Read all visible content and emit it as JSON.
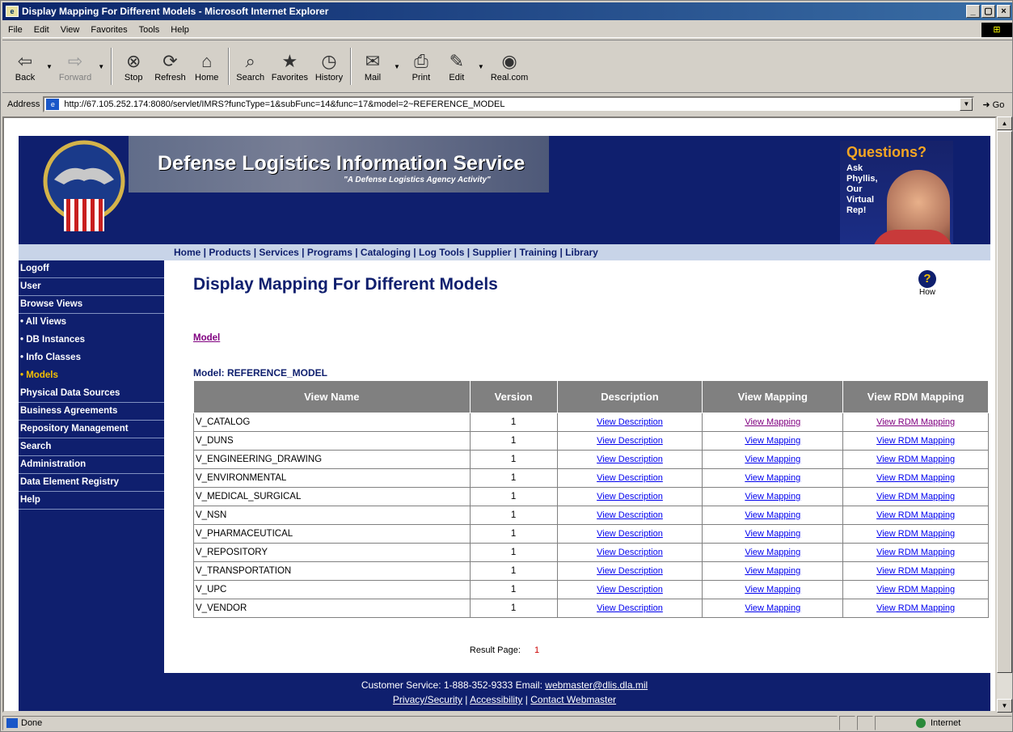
{
  "window": {
    "title": "Display Mapping For Different Models - Microsoft Internet Explorer",
    "icon": "ie-page-icon",
    "controls": [
      "minimize",
      "maximize",
      "close"
    ]
  },
  "menu": [
    "File",
    "Edit",
    "View",
    "Favorites",
    "Tools",
    "Help"
  ],
  "toolbar": [
    {
      "label": "Back",
      "icon": "back-arrow-icon",
      "glyph": "⇦",
      "enabled": true
    },
    {
      "label": "Forward",
      "icon": "forward-arrow-icon",
      "glyph": "⇨",
      "enabled": false
    },
    {
      "label": "Stop",
      "icon": "stop-icon",
      "glyph": "⊗",
      "enabled": true
    },
    {
      "label": "Refresh",
      "icon": "refresh-icon",
      "glyph": "⟳",
      "enabled": true
    },
    {
      "label": "Home",
      "icon": "home-icon",
      "glyph": "⌂",
      "enabled": true
    },
    {
      "label": "Search",
      "icon": "search-icon",
      "glyph": "⌕",
      "enabled": true
    },
    {
      "label": "Favorites",
      "icon": "favorites-icon",
      "glyph": "★",
      "enabled": true
    },
    {
      "label": "History",
      "icon": "history-icon",
      "glyph": "◷",
      "enabled": true
    },
    {
      "label": "Mail",
      "icon": "mail-icon",
      "glyph": "✉",
      "enabled": true
    },
    {
      "label": "Print",
      "icon": "print-icon",
      "glyph": "⎙",
      "enabled": true
    },
    {
      "label": "Edit",
      "icon": "edit-icon",
      "glyph": "✎",
      "enabled": true
    },
    {
      "label": "Real.com",
      "icon": "real-icon",
      "glyph": "◉",
      "enabled": true
    }
  ],
  "address": {
    "label": "Address",
    "url": "http://67.105.252.174:8080/servlet/IMRS?funcType=1&subFunc=14&func=17&model=2~REFERENCE_MODEL",
    "go_label": "Go"
  },
  "banner": {
    "title": "Defense Logistics Information Service",
    "subtitle": "\"A Defense Logistics Agency Activity\"",
    "questions_title": "Questions?",
    "questions_lines": [
      "Ask",
      "Phyllis,",
      "Our",
      "Virtual",
      "Rep!"
    ]
  },
  "nav": [
    "Home",
    "Products",
    "Services",
    "Programs",
    "Cataloging",
    "Log Tools",
    "Supplier",
    "Training",
    "Library"
  ],
  "sidebar": [
    {
      "label": "Logoff",
      "sub": false,
      "active": false
    },
    {
      "label": "User",
      "sub": false,
      "active": false
    },
    {
      "label": "Browse Views",
      "sub": false,
      "active": false
    },
    {
      "label": "• All Views",
      "sub": true,
      "active": false
    },
    {
      "label": "• DB Instances",
      "sub": true,
      "active": false
    },
    {
      "label": "• Info Classes",
      "sub": true,
      "active": false
    },
    {
      "label": "• Models",
      "sub": true,
      "active": true
    },
    {
      "label": "Physical Data Sources",
      "sub": false,
      "active": false
    },
    {
      "label": "Business Agreements",
      "sub": false,
      "active": false
    },
    {
      "label": "Repository Management",
      "sub": false,
      "active": false
    },
    {
      "label": "Search",
      "sub": false,
      "active": false
    },
    {
      "label": "Administration",
      "sub": false,
      "active": false
    },
    {
      "label": "Data Element Registry",
      "sub": false,
      "active": false
    },
    {
      "label": "Help",
      "sub": false,
      "active": false
    }
  ],
  "main": {
    "title": "Display Mapping For Different Models",
    "help_label": "How",
    "breadcrumb": "Model",
    "model_label": "Model: REFERENCE_MODEL",
    "columns": [
      "View Name",
      "Version",
      "Description",
      "View Mapping",
      "View RDM Mapping"
    ],
    "rows": [
      {
        "view": "V_CATALOG",
        "version": "1",
        "desc": "View Description",
        "mapping": "View Mapping",
        "rdm": "View RDM Mapping"
      },
      {
        "view": "V_DUNS",
        "version": "1",
        "desc": "View Description",
        "mapping": "View Mapping",
        "rdm": "View RDM Mapping"
      },
      {
        "view": "V_ENGINEERING_DRAWING",
        "version": "1",
        "desc": "View Description",
        "mapping": "View Mapping",
        "rdm": "View RDM Mapping"
      },
      {
        "view": "V_ENVIRONMENTAL",
        "version": "1",
        "desc": "View Description",
        "mapping": "View Mapping",
        "rdm": "View RDM Mapping"
      },
      {
        "view": "V_MEDICAL_SURGICAL",
        "version": "1",
        "desc": "View Description",
        "mapping": "View Mapping",
        "rdm": "View RDM Mapping"
      },
      {
        "view": "V_NSN",
        "version": "1",
        "desc": "View Description",
        "mapping": "View Mapping",
        "rdm": "View RDM Mapping"
      },
      {
        "view": "V_PHARMACEUTICAL",
        "version": "1",
        "desc": "View Description",
        "mapping": "View Mapping",
        "rdm": "View RDM Mapping"
      },
      {
        "view": "V_REPOSITORY",
        "version": "1",
        "desc": "View Description",
        "mapping": "View Mapping",
        "rdm": "View RDM Mapping"
      },
      {
        "view": "V_TRANSPORTATION",
        "version": "1",
        "desc": "View Description",
        "mapping": "View Mapping",
        "rdm": "View RDM Mapping"
      },
      {
        "view": "V_UPC",
        "version": "1",
        "desc": "View Description",
        "mapping": "View Mapping",
        "rdm": "View RDM Mapping"
      },
      {
        "view": "V_VENDOR",
        "version": "1",
        "desc": "View Description",
        "mapping": "View Mapping",
        "rdm": "View RDM Mapping"
      }
    ],
    "result_page_label": "Result Page:",
    "result_page_num": "1"
  },
  "footer": {
    "service_text": "Customer Service: 1-888-352-9333 Email:",
    "email": "webmaster@dlis.dla.mil",
    "links": [
      "Privacy/Security",
      "Accessibility",
      "Contact Webmaster"
    ]
  },
  "status": {
    "text": "Done",
    "zone": "Internet"
  },
  "colors": {
    "navy": "#0f1f6e",
    "gold": "#f5c000",
    "link": "#0000ee",
    "visited": "#800080",
    "table_header": "#808080"
  }
}
